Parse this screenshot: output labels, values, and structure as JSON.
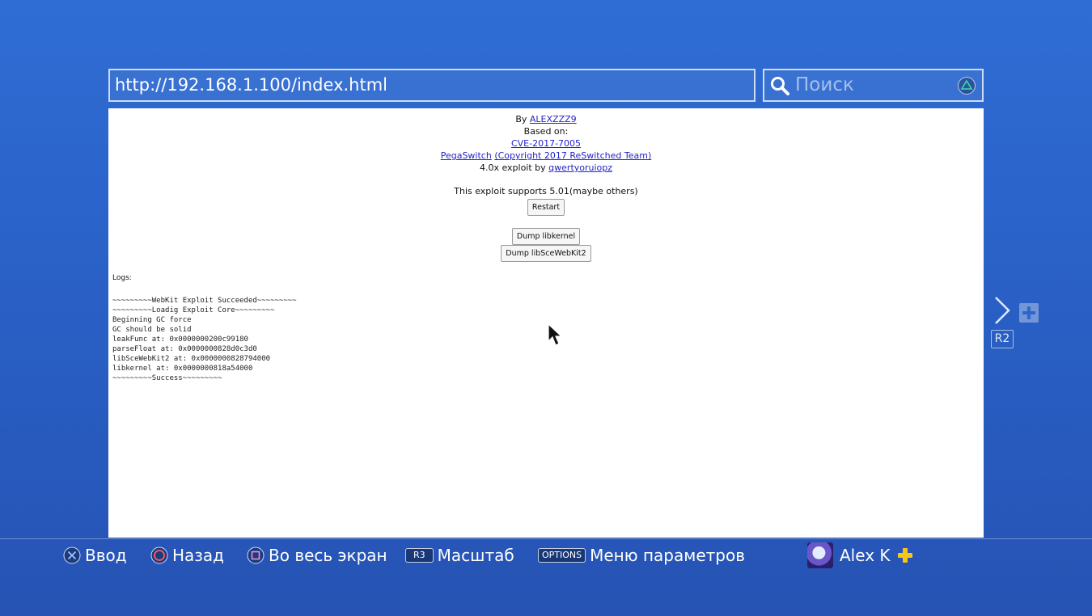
{
  "address_bar": {
    "url": "http://192.168.1.100/index.html"
  },
  "search": {
    "placeholder": "Поиск"
  },
  "page": {
    "by_label": "By",
    "author": "ALEXZZZ9",
    "based_on": "Based on:",
    "cve_link": "CVE-2017-7005",
    "pegaswitch_link": "PegaSwitch",
    "copyright_link": "(Copyright 2017 ReSwitched Team)",
    "exploit_by_label": "4.0x exploit by",
    "exploit_author": "qwertyoruiopz",
    "support_text": "This exploit supports 5.01(maybe others)",
    "restart_button": "Restart",
    "dump_libkernel_button": "Dump libkernel",
    "dump_webkit_button": "Dump libSceWebKit2",
    "logs_label": "Logs:",
    "log_lines": [
      "~~~~~~~~~WebKit Exploit Succeeded~~~~~~~~~",
      "~~~~~~~~~Loadig Exploit Core~~~~~~~~~",
      "Beginning GC force",
      "GC should be solid",
      "leakFunc at: 0x0000000200c99180",
      "parseFloat at: 0x0000000828d0c3d0",
      "libSceWebKit2 at: 0x0000000828794000",
      "libkernel at: 0x0000000818a54000",
      "~~~~~~~~~Success~~~~~~~~~"
    ]
  },
  "side": {
    "r2_label": "R2"
  },
  "hints": {
    "enter": "Ввод",
    "back": "Назад",
    "fullscreen": "Во весь экран",
    "r3_badge": "R3",
    "zoom": "Масштаб",
    "options_badge": "OPTIONS",
    "options_menu": "Меню параметров"
  },
  "user": {
    "name": "Alex K"
  },
  "colors": {
    "background": "#2a62c8",
    "link": "#2323c8",
    "plus": "#f5c518"
  }
}
